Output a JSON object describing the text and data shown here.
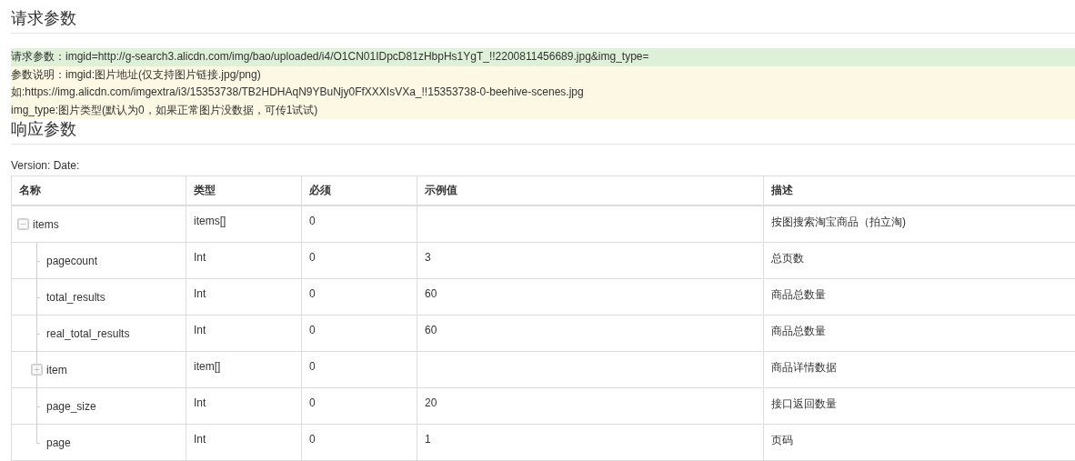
{
  "request_section": {
    "title": "请求参数",
    "notes": [
      {
        "kind": "success",
        "text": "请求参数：imgid=http://g-search3.alicdn.com/img/bao/uploaded/i4/O1CN01IDpcD81zHbpHs1YgT_!!2200811456689.jpg&img_type="
      },
      {
        "kind": "warning",
        "text": "参数说明：imgid:图片地址(仅支持图片链接.jpg/png)"
      },
      {
        "kind": "warning",
        "text": "如:https://img.alicdn.com/imgextra/i3/15353738/TB2HDHAqN9YBuNjy0FfXXXIsVXa_!!15353738-0-beehive-scenes.jpg"
      },
      {
        "kind": "warning",
        "text": "img_type:图片类型(默认为0，如果正常图片没数据，可传1试试)"
      }
    ]
  },
  "response_section": {
    "title": "响应参数",
    "version_line": "Version: Date:",
    "table": {
      "columns": [
        "名称",
        "类型",
        "必须",
        "示例值",
        "描述"
      ],
      "rows": [
        {
          "name": "items",
          "type": "items[]",
          "required": "0",
          "description": "按图搜索淘宝商品（拍立淘)",
          "expanded": true,
          "children": [
            {
              "name": "pagecount",
              "type": "Int",
              "required": "0",
              "example": "3",
              "description": "总页数"
            },
            {
              "name": "total_results",
              "type": "Int",
              "required": "0",
              "example": "60",
              "description": "商品总数量"
            },
            {
              "name": "real_total_results",
              "type": "Int",
              "required": "0",
              "example": "60",
              "description": "商品总数量"
            },
            {
              "name": "item",
              "type": "item[]",
              "required": "0",
              "description": "商品详情数据",
              "expanded": false
            },
            {
              "name": "page_size",
              "type": "Int",
              "required": "0",
              "example": "20",
              "description": "接口返回数量"
            },
            {
              "name": "page",
              "type": "Int",
              "required": "0",
              "example": "1",
              "description": "页码"
            }
          ]
        }
      ]
    }
  }
}
